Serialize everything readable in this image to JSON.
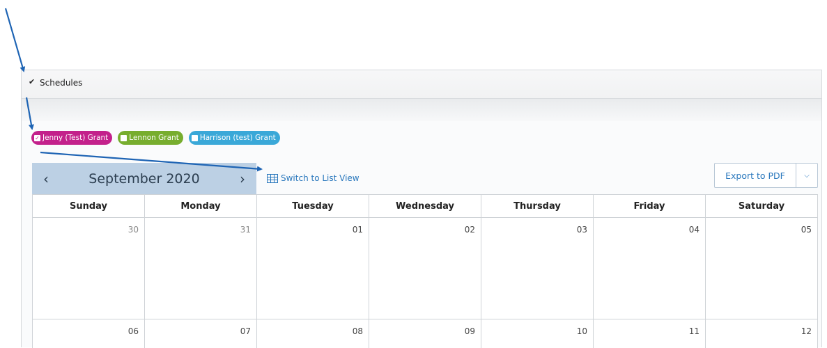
{
  "panel": {
    "title": "Schedules"
  },
  "chips": [
    {
      "label": "Jenny (Test) Grant",
      "checked": true,
      "color": "#c3218b"
    },
    {
      "label": "Lennon Grant",
      "checked": false,
      "color": "#77ad2e"
    },
    {
      "label": "Harrison (test) Grant",
      "checked": false,
      "color": "#3aa8d8"
    }
  ],
  "calendar": {
    "month_title": "September 2020",
    "prev_icon": "chevron-left-icon",
    "next_icon": "chevron-right-icon",
    "switch_label": "Switch to List View",
    "export_label": "Export to PDF",
    "weekdays": [
      "Sunday",
      "Monday",
      "Tuesday",
      "Wednesday",
      "Thursday",
      "Friday",
      "Saturday"
    ],
    "weeks": [
      [
        "30",
        "31",
        "01",
        "02",
        "03",
        "04",
        "05"
      ],
      [
        "06",
        "07",
        "08",
        "09",
        "10",
        "11",
        "12"
      ]
    ]
  },
  "colors": {
    "accent": "#2a78bd",
    "nav_bg": "#bcd0e4",
    "annotation_arrow": "#1e64b4"
  }
}
